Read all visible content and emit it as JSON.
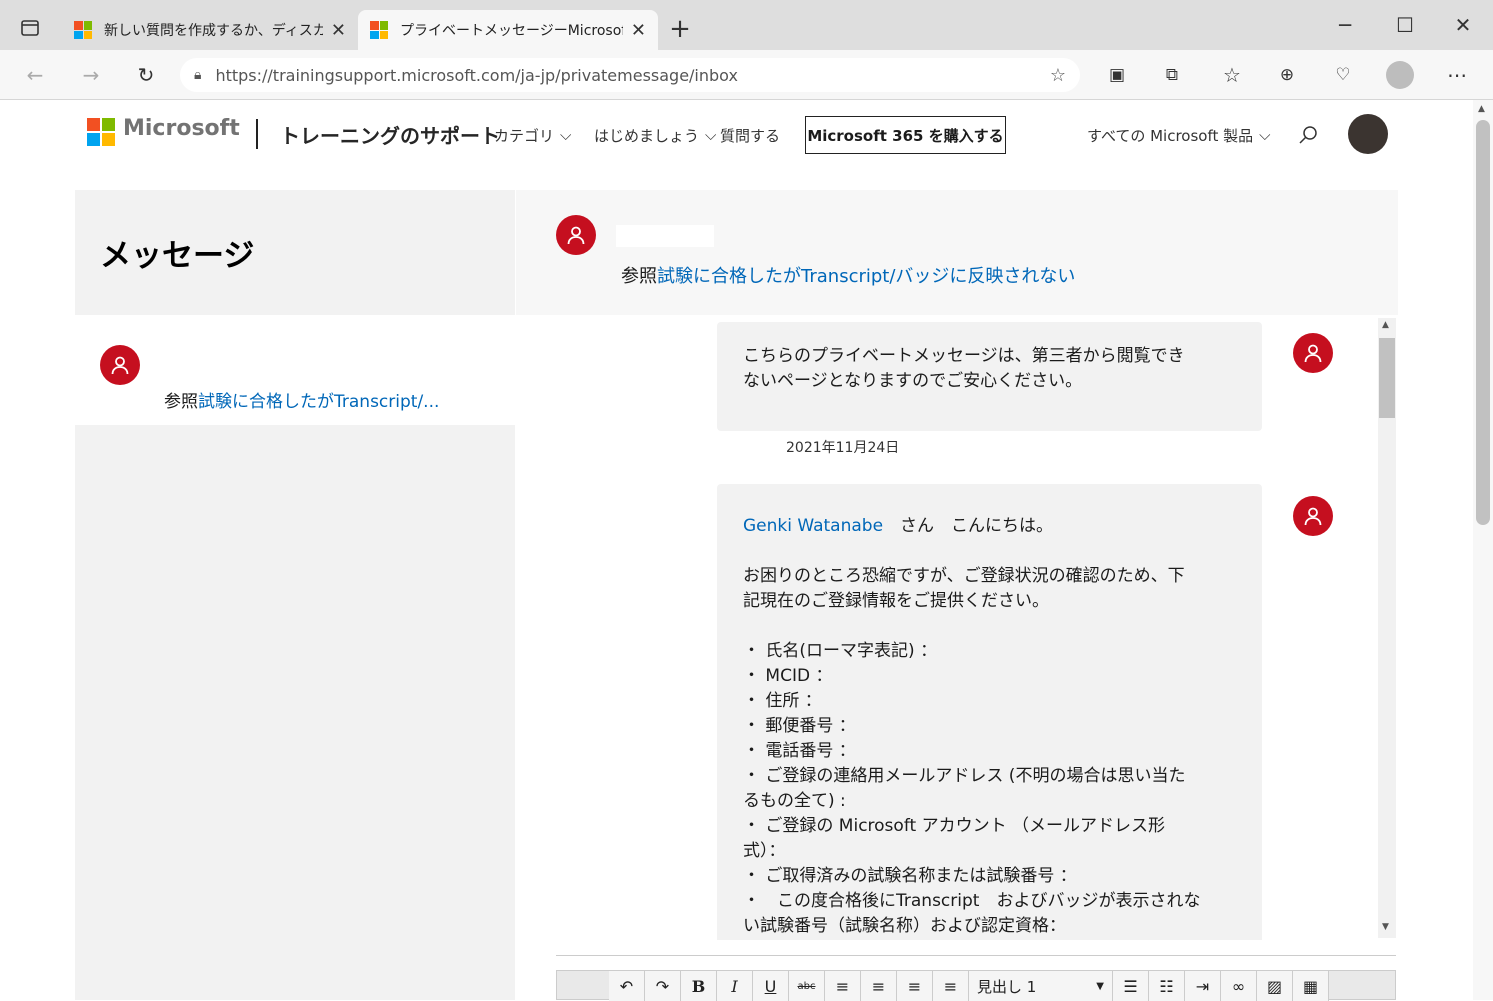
{
  "browser": {
    "tabs": [
      {
        "title": "新しい質問を作成するか、ディスカッ",
        "active": false
      },
      {
        "title": "プライベートメッセージーMicrosoftコミ",
        "active": true
      }
    ],
    "new_tab": "+",
    "url": "https://trainingsupport.microsoft.com/ja-jp/privatemessage/inbox"
  },
  "site": {
    "brand": "Microsoft",
    "title": "トレーニングのサポート",
    "nav": [
      "カテゴリ",
      "はじめましょう",
      "質問する"
    ],
    "buy_button": "Microsoft 365 を購入する",
    "all_products": "すべての Microsoft 製品"
  },
  "messages_heading": "メッセージ",
  "thread_header": {
    "ref_label": "参照",
    "ref_link": "試験に合格したがTranscript/バッジに反映されない"
  },
  "inbox_item": {
    "ref_label": "参照",
    "ref_link": "試験に合格したがTranscript/..."
  },
  "messages": [
    {
      "lines": [
        "こちらのプライベートメッセージは、第三者から閲覧でき",
        "ないページとなりますのでご安心ください。"
      ],
      "date": "2021年11月24日"
    },
    {
      "greeting_name": "Genki Watanabe",
      "greeting_rest": "　さん　こんにちは。",
      "body": [
        "お困りのところ恐縮ですが、ご登録状況の確認のため、下",
        "記現在のご登録情報をご提供ください。",
        "",
        "・ 氏名(ローマ字表記) ：",
        "・ MCID ：",
        "・ 住所 ：",
        "・ 郵便番号 ：",
        "・ 電話番号 ：",
        "・ ご登録の連絡用メールアドレス (不明の場合は思い当た",
        "るもの全て) :",
        "・ ご登録の Microsoft アカウント （メールアドレス形",
        "式）：",
        "・ ご取得済みの試験名称または試験番号 ：",
        "・　この度合格後にTranscript　およびバッジが表示されな",
        "い試験番号（試験名称）および認定資格："
      ]
    }
  ],
  "editor": {
    "heading_select": "見出し 1",
    "buttons": [
      "↶",
      "↷",
      "B",
      "I",
      "U",
      "abc"
    ]
  },
  "colors": {
    "accent": "#0067b8",
    "avatar": "#c50f1f"
  }
}
